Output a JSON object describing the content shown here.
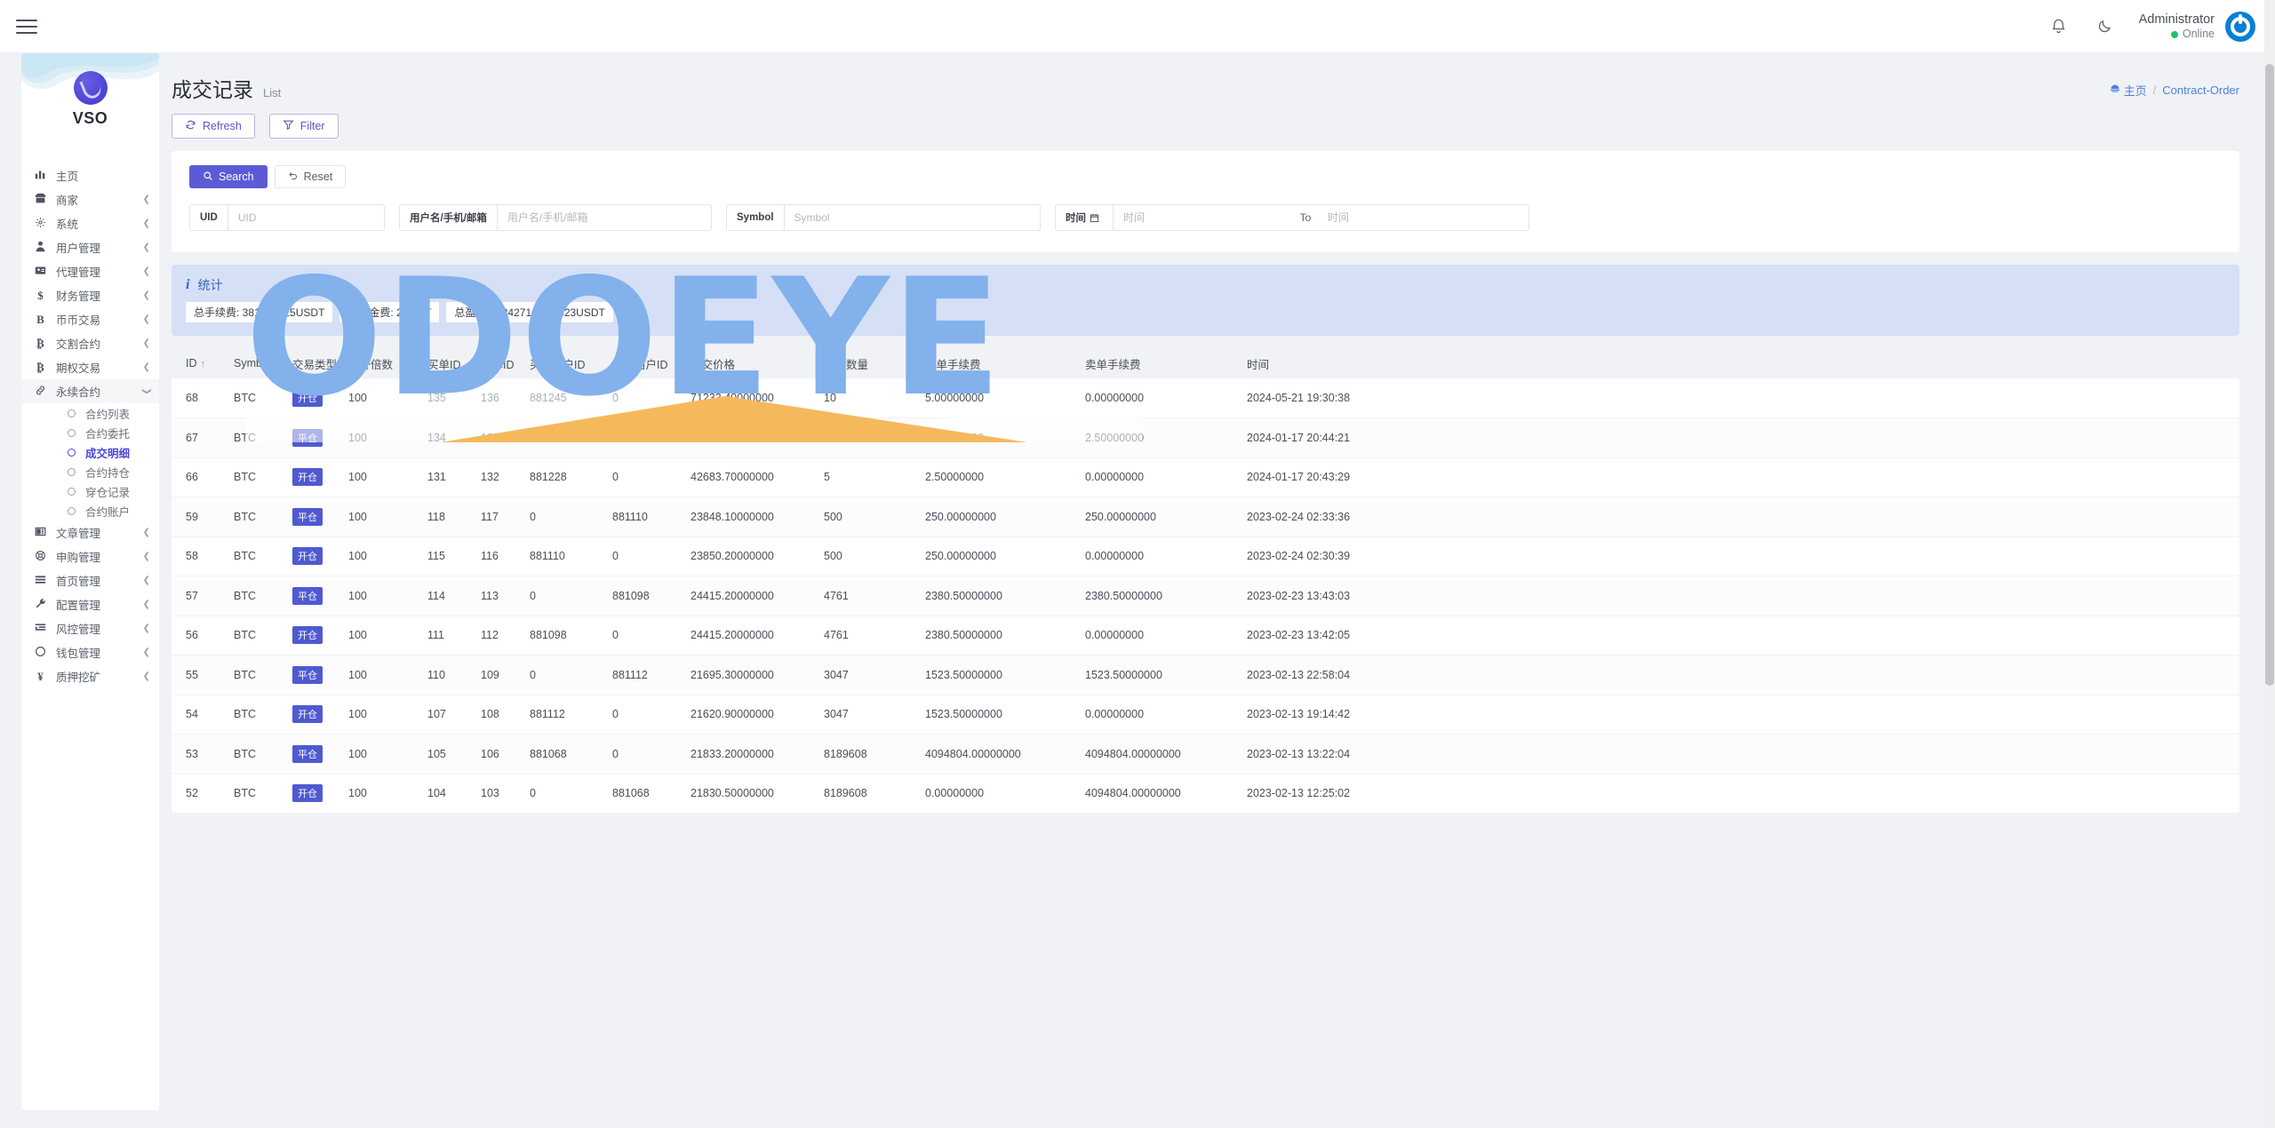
{
  "topbar": {
    "menu_toggle": "menu-toggle",
    "notification_icon": "bell-icon",
    "theme_icon": "moon-icon",
    "user_name": "Administrator",
    "user_status": "Online"
  },
  "sidebar": {
    "brand": "VSO",
    "items": [
      {
        "label": "主页",
        "icon": "chart-bar-icon",
        "expandable": false
      },
      {
        "label": "商家",
        "icon": "store-icon",
        "expandable": true
      },
      {
        "label": "系统",
        "icon": "gear-icon",
        "expandable": true
      },
      {
        "label": "用户管理",
        "icon": "user-shield-icon",
        "expandable": true
      },
      {
        "label": "代理管理",
        "icon": "id-card-icon",
        "expandable": true
      },
      {
        "label": "财务管理",
        "icon": "dollar-icon",
        "expandable": true
      },
      {
        "label": "币币交易",
        "icon": "b-letter-icon",
        "expandable": true
      },
      {
        "label": "交割合约",
        "icon": "bitcoin-icon",
        "expandable": true
      },
      {
        "label": "期权交易",
        "icon": "bitcoin-icon",
        "expandable": true
      },
      {
        "label": "永续合约",
        "icon": "link-icon",
        "expandable": true,
        "expanded": true,
        "active": true,
        "children": [
          {
            "label": "合约列表"
          },
          {
            "label": "合约委托"
          },
          {
            "label": "成交明细",
            "current": true
          },
          {
            "label": "合约持仓"
          },
          {
            "label": "穿仓记录"
          },
          {
            "label": "合约账户"
          }
        ]
      },
      {
        "label": "文章管理",
        "icon": "newspaper-icon",
        "expandable": true
      },
      {
        "label": "申购管理",
        "icon": "lifebuoy-icon",
        "expandable": true
      },
      {
        "label": "首页管理",
        "icon": "bars-icon",
        "expandable": true
      },
      {
        "label": "配置管理",
        "icon": "wrench-icon",
        "expandable": true
      },
      {
        "label": "风控管理",
        "icon": "indent-icon",
        "expandable": true
      },
      {
        "label": "钱包管理",
        "icon": "circle-icon",
        "expandable": true
      },
      {
        "label": "质押挖矿",
        "icon": "yen-icon",
        "expandable": true
      }
    ]
  },
  "page": {
    "title": "成交记录",
    "title_sub": "List",
    "breadcrumb_home": "主页",
    "breadcrumb_home_icon": "dashboard-icon",
    "breadcrumb_sep": "/",
    "breadcrumb_current": "Contract-Order",
    "refresh_label": "Refresh",
    "refresh_icon": "refresh-icon",
    "filter_label": "Filter",
    "filter_icon": "funnel-icon"
  },
  "search": {
    "search_label": "Search",
    "search_icon": "search-icon",
    "reset_label": "Reset",
    "reset_icon": "undo-icon",
    "fields": [
      {
        "name": "uid",
        "label": "UID",
        "value": "",
        "placeholder": "UID"
      },
      {
        "name": "user",
        "label": "用户名/手机/邮箱",
        "value": "",
        "placeholder": "用户名/手机/邮箱"
      },
      {
        "name": "symbol",
        "label": "Symbol",
        "value": "",
        "placeholder": "Symbol"
      }
    ],
    "date_from": {
      "label": "时间",
      "icon": "calendar-icon",
      "value": "",
      "placeholder": "时间"
    },
    "date_to": {
      "label": "To",
      "value": "",
      "placeholder": "时间"
    }
  },
  "stats": {
    "title": "统计",
    "icon": "info-icon",
    "chips": [
      "总手续费: 381754615USDT",
      "总资金费: 2USDT",
      "总盈亏: -12427168.90523USDT"
    ]
  },
  "table": {
    "columns": [
      "ID",
      "Symbol",
      "交易类型",
      "杠杆倍数",
      "买单ID",
      "卖单ID",
      "买家用户ID",
      "卖家用户ID",
      "成交价格",
      "交易数量",
      "买单手续费",
      "卖单手续费",
      "时间"
    ],
    "sort_column": "ID",
    "sort_icon": "arrow-up-icon",
    "rows": [
      {
        "id": "68",
        "symbol": "BTC",
        "type": "开仓",
        "leverage": "100",
        "buy_order": "135",
        "sell_order": "136",
        "buyer_uid": "881245",
        "seller_uid": "0",
        "price": "71233.40000000",
        "qty": "10",
        "buy_fee": "5.00000000",
        "sell_fee": "0.00000000",
        "time": "2024-05-21 19:30:38"
      },
      {
        "id": "67",
        "symbol": "BTC",
        "type": "平仓",
        "leverage": "100",
        "buy_order": "134",
        "sell_order": "133",
        "buyer_uid": "0",
        "seller_uid": "881228",
        "price": "42659.90000000",
        "qty": "5",
        "buy_fee": "2.50000000",
        "sell_fee": "2.50000000",
        "time": "2024-01-17 20:44:21"
      },
      {
        "id": "66",
        "symbol": "BTC",
        "type": "开仓",
        "leverage": "100",
        "buy_order": "131",
        "sell_order": "132",
        "buyer_uid": "881228",
        "seller_uid": "0",
        "price": "42683.70000000",
        "qty": "5",
        "buy_fee": "2.50000000",
        "sell_fee": "0.00000000",
        "time": "2024-01-17 20:43:29"
      },
      {
        "id": "59",
        "symbol": "BTC",
        "type": "平仓",
        "leverage": "100",
        "buy_order": "118",
        "sell_order": "117",
        "buyer_uid": "0",
        "seller_uid": "881110",
        "price": "23848.10000000",
        "qty": "500",
        "buy_fee": "250.00000000",
        "sell_fee": "250.00000000",
        "time": "2023-02-24 02:33:36"
      },
      {
        "id": "58",
        "symbol": "BTC",
        "type": "开仓",
        "leverage": "100",
        "buy_order": "115",
        "sell_order": "116",
        "buyer_uid": "881110",
        "seller_uid": "0",
        "price": "23850.20000000",
        "qty": "500",
        "buy_fee": "250.00000000",
        "sell_fee": "0.00000000",
        "time": "2023-02-24 02:30:39"
      },
      {
        "id": "57",
        "symbol": "BTC",
        "type": "平仓",
        "leverage": "100",
        "buy_order": "114",
        "sell_order": "113",
        "buyer_uid": "0",
        "seller_uid": "881098",
        "price": "24415.20000000",
        "qty": "4761",
        "buy_fee": "2380.50000000",
        "sell_fee": "2380.50000000",
        "time": "2023-02-23 13:43:03"
      },
      {
        "id": "56",
        "symbol": "BTC",
        "type": "开仓",
        "leverage": "100",
        "buy_order": "111",
        "sell_order": "112",
        "buyer_uid": "881098",
        "seller_uid": "0",
        "price": "24415.20000000",
        "qty": "4761",
        "buy_fee": "2380.50000000",
        "sell_fee": "0.00000000",
        "time": "2023-02-23 13:42:05"
      },
      {
        "id": "55",
        "symbol": "BTC",
        "type": "平仓",
        "leverage": "100",
        "buy_order": "110",
        "sell_order": "109",
        "buyer_uid": "0",
        "seller_uid": "881112",
        "price": "21695.30000000",
        "qty": "3047",
        "buy_fee": "1523.50000000",
        "sell_fee": "1523.50000000",
        "time": "2023-02-13 22:58:04"
      },
      {
        "id": "54",
        "symbol": "BTC",
        "type": "开仓",
        "leverage": "100",
        "buy_order": "107",
        "sell_order": "108",
        "buyer_uid": "881112",
        "seller_uid": "0",
        "price": "21620.90000000",
        "qty": "3047",
        "buy_fee": "1523.50000000",
        "sell_fee": "0.00000000",
        "time": "2023-02-13 19:14:42"
      },
      {
        "id": "53",
        "symbol": "BTC",
        "type": "平仓",
        "leverage": "100",
        "buy_order": "105",
        "sell_order": "106",
        "buyer_uid": "881068",
        "seller_uid": "0",
        "price": "21833.20000000",
        "qty": "8189608",
        "buy_fee": "4094804.00000000",
        "sell_fee": "4094804.00000000",
        "time": "2023-02-13 13:22:04"
      },
      {
        "id": "52",
        "symbol": "BTC",
        "type": "开仓",
        "leverage": "100",
        "buy_order": "104",
        "sell_order": "103",
        "buyer_uid": "0",
        "seller_uid": "881068",
        "price": "21830.50000000",
        "qty": "8189608",
        "buy_fee": "0.00000000",
        "sell_fee": "4094804.00000000",
        "time": "2023-02-13 12:25:02"
      }
    ]
  },
  "watermark": {
    "text": "ODOEYE"
  },
  "colors": {
    "accent": "#5b5bd6",
    "badge": "#4f5ad0",
    "stats_bg": "#d5e0f7",
    "stats_text": "#3a63b8",
    "page_bg": "#f0f2f5",
    "online": "#1ec16a",
    "watermark": "#82b1ec",
    "watermark_band": "#f5b95c"
  }
}
